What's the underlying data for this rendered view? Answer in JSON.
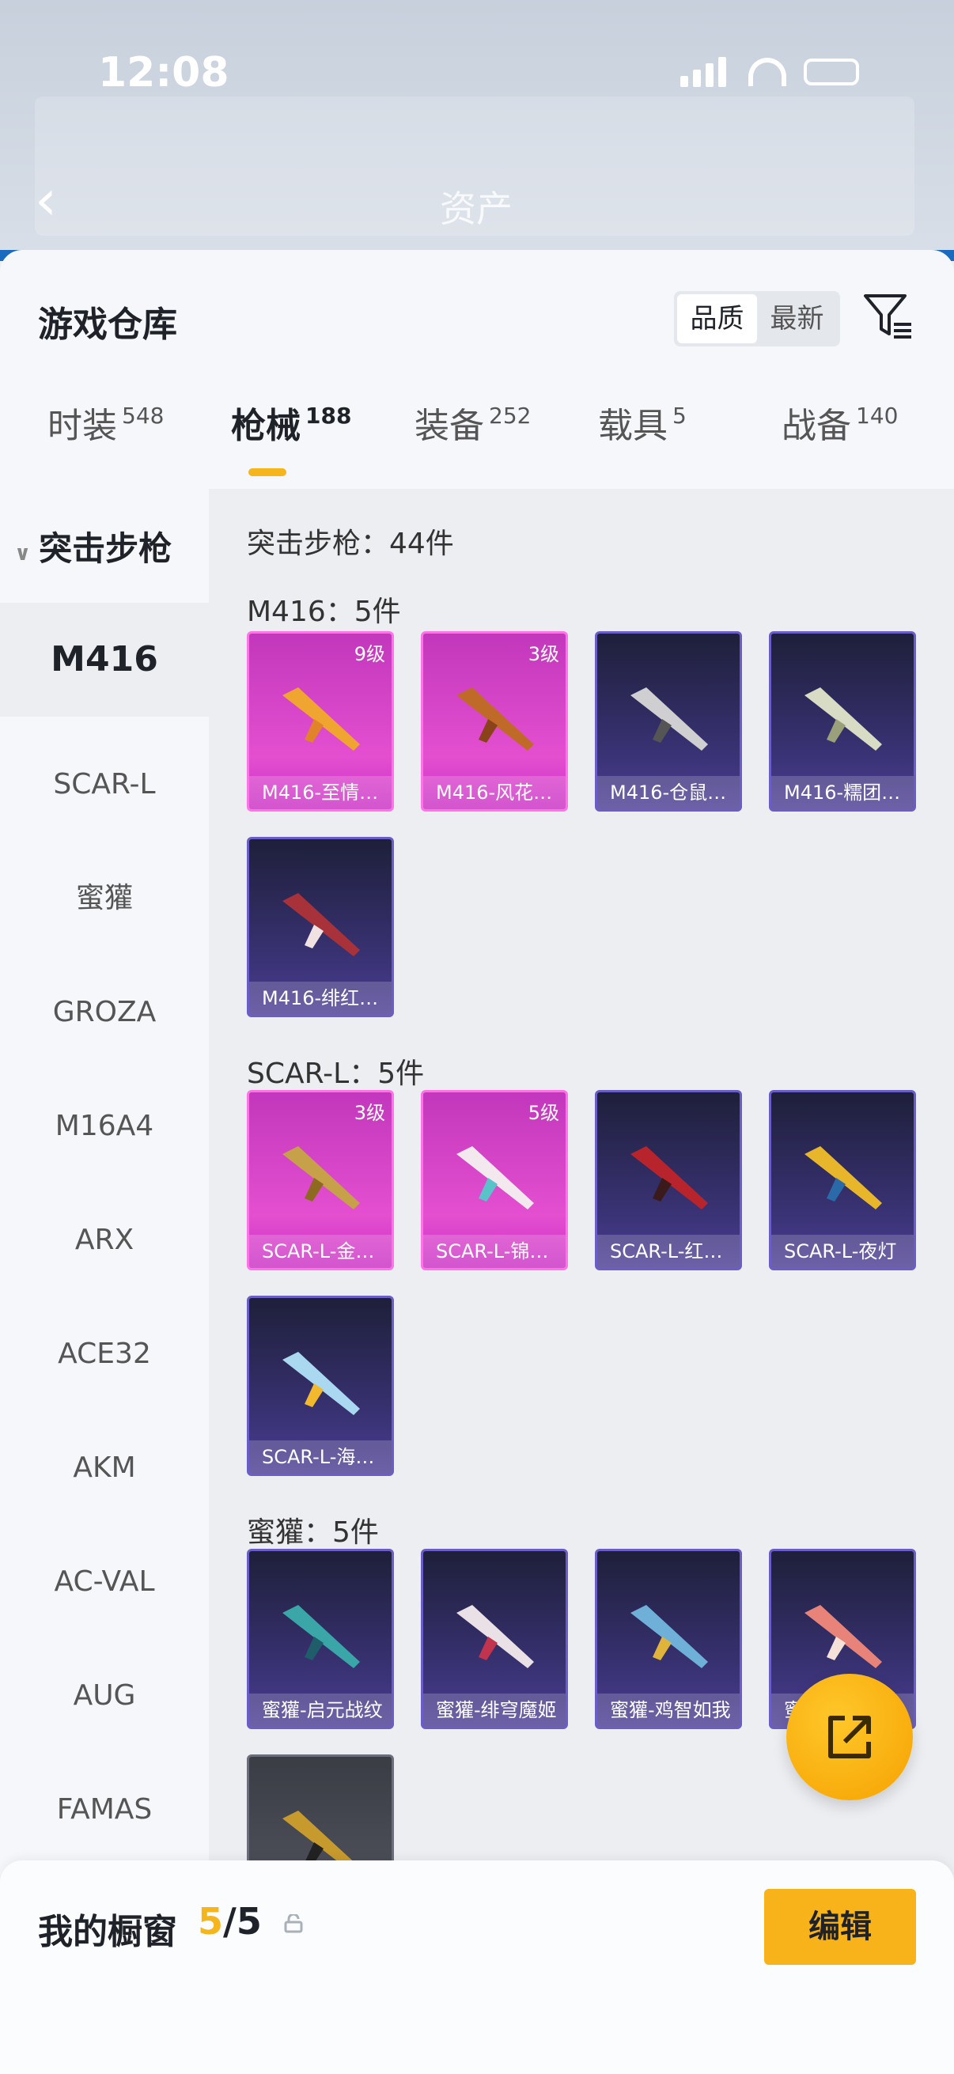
{
  "status": {
    "time": "12:08"
  },
  "background": {
    "asset_label": "资产"
  },
  "sheet": {
    "title": "游戏仓库",
    "sort": {
      "quality": "品质",
      "newest": "最新"
    }
  },
  "tabs": [
    {
      "label": "时装",
      "count": "548"
    },
    {
      "label": "枪械",
      "count": "188"
    },
    {
      "label": "装备",
      "count": "252"
    },
    {
      "label": "载具",
      "count": "5"
    },
    {
      "label": "战备",
      "count": "140"
    }
  ],
  "leftnav": {
    "category": "突击步枪",
    "items": [
      "M416",
      "SCAR-L",
      "蜜獾",
      "GROZA",
      "M16A4",
      "ARX",
      "ACE32",
      "AKM",
      "AC-VAL",
      "AUG",
      "FAMAS"
    ]
  },
  "content": {
    "category_header": "突击步枪：44件",
    "groups": [
      {
        "header": "M416：5件",
        "items": [
          {
            "name": "M416-至情…",
            "level": "9级",
            "rarity": "pink"
          },
          {
            "name": "M416-风花…",
            "level": "3级",
            "rarity": "pink"
          },
          {
            "name": "M416-仓鼠…",
            "level": "",
            "rarity": "blue"
          },
          {
            "name": "M416-糯团…",
            "level": "",
            "rarity": "blue"
          },
          {
            "name": "M416-绯红…",
            "level": "",
            "rarity": "blue"
          }
        ]
      },
      {
        "header": "SCAR-L：5件",
        "items": [
          {
            "name": "SCAR-L-金…",
            "level": "3级",
            "rarity": "pink"
          },
          {
            "name": "SCAR-L-锦…",
            "level": "5级",
            "rarity": "pink"
          },
          {
            "name": "SCAR-L-红…",
            "level": "",
            "rarity": "blue"
          },
          {
            "name": "SCAR-L-夜灯",
            "level": "",
            "rarity": "blue"
          },
          {
            "name": "SCAR-L-海…",
            "level": "",
            "rarity": "blue"
          }
        ]
      },
      {
        "header": "蜜獾：5件",
        "items": [
          {
            "name": "蜜獾-启元战纹",
            "level": "",
            "rarity": "blue"
          },
          {
            "name": "蜜獾-绯穹魔姬",
            "level": "",
            "rarity": "blue"
          },
          {
            "name": "蜜獾-鸡智如我",
            "level": "",
            "rarity": "blue"
          },
          {
            "name": "蜜",
            "level": "",
            "rarity": "blue"
          },
          {
            "name": "",
            "level": "",
            "rarity": "gray"
          }
        ]
      }
    ]
  },
  "showcase": {
    "title": "我的橱窗",
    "current": "5",
    "total": "/5",
    "edit_label": "编辑"
  },
  "colors": {
    "accent": "#f5b51d",
    "pink_rarity": "#e44fd0",
    "blue_rarity": "#4d3d95"
  }
}
